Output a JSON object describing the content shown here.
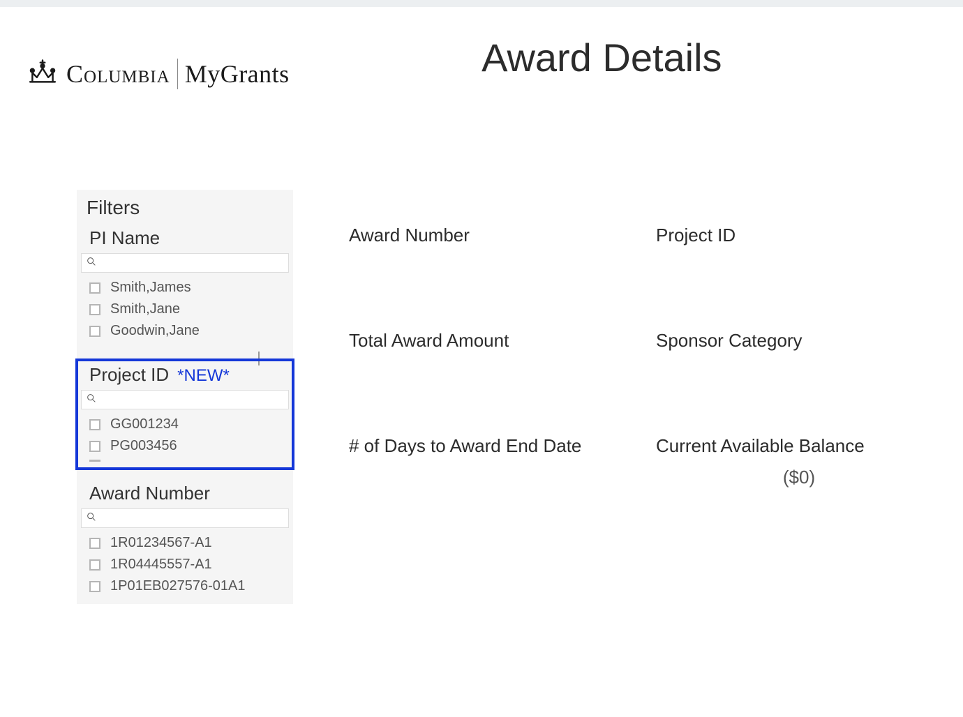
{
  "brand": {
    "name_main": "Columbia",
    "name_sub": "MyGrants"
  },
  "page_title": "Award Details",
  "filters": {
    "title": "Filters",
    "pi_name": {
      "label": "PI Name",
      "search_value": "",
      "items": [
        "Smith,James",
        "Smith,Jane",
        "Goodwin,Jane"
      ]
    },
    "project_id": {
      "label": "Project ID",
      "badge": "*NEW*",
      "search_value": "",
      "items": [
        "GG001234",
        "PG003456"
      ]
    },
    "award_number": {
      "label": "Award Number",
      "search_value": "",
      "items": [
        "1R01234567-A1",
        "1R04445557-A1",
        "1P01EB027576-01A1"
      ]
    }
  },
  "details": {
    "award_number": {
      "label": "Award Number"
    },
    "project_id": {
      "label": "Project ID"
    },
    "total_award_amount": {
      "label": "Total Award Amount"
    },
    "sponsor_category": {
      "label": "Sponsor Category"
    },
    "days_to_end": {
      "label": "# of Days to Award End Date"
    },
    "current_balance": {
      "label": "Current Available Balance",
      "value": "($0)"
    }
  }
}
